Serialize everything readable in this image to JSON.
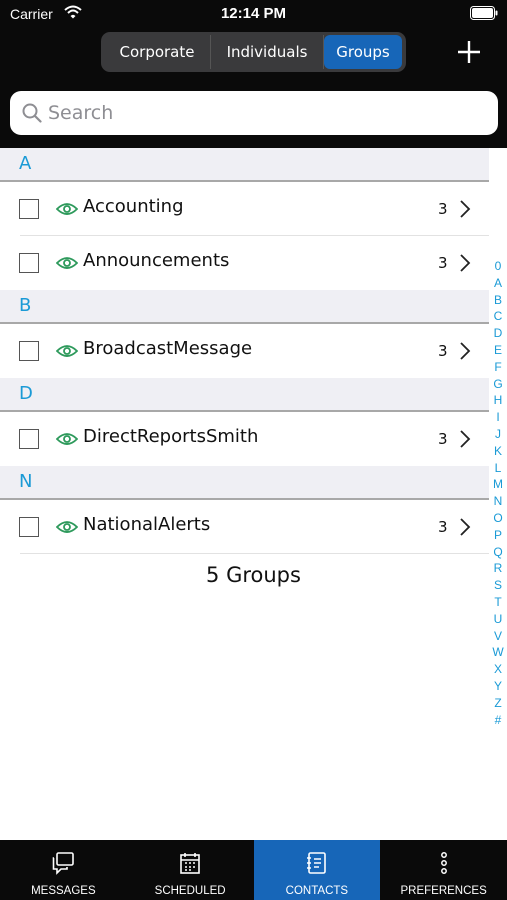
{
  "status": {
    "carrier": "Carrier",
    "time": "12:14 PM"
  },
  "segments": [
    {
      "label": "Corporate",
      "selected": false
    },
    {
      "label": "Individuals",
      "selected": false
    },
    {
      "label": "Groups",
      "selected": true
    }
  ],
  "search": {
    "placeholder": "Search",
    "value": ""
  },
  "sections": [
    {
      "letter": "A",
      "rows": [
        {
          "name": "Accounting",
          "count": "3"
        },
        {
          "name": "Announcements",
          "count": "3"
        }
      ]
    },
    {
      "letter": "B",
      "rows": [
        {
          "name": "BroadcastMessage",
          "count": "3"
        }
      ]
    },
    {
      "letter": "D",
      "rows": [
        {
          "name": "DirectReportsSmith",
          "count": "3"
        }
      ]
    },
    {
      "letter": "N",
      "rows": [
        {
          "name": "NationalAlerts",
          "count": "3"
        }
      ]
    }
  ],
  "footer": {
    "count_text": "5 Groups"
  },
  "index_letters": [
    "0",
    "A",
    "B",
    "C",
    "D",
    "E",
    "F",
    "G",
    "H",
    "I",
    "J",
    "K",
    "L",
    "M",
    "N",
    "O",
    "P",
    "Q",
    "R",
    "S",
    "T",
    "U",
    "V",
    "W",
    "X",
    "Y",
    "Z",
    "#"
  ],
  "tabs": [
    {
      "label": "MESSAGES",
      "icon": "messages-icon",
      "active": false
    },
    {
      "label": "SCHEDULED",
      "icon": "calendar-icon",
      "active": false
    },
    {
      "label": "CONTACTS",
      "icon": "contacts-icon",
      "active": true
    },
    {
      "label": "PREFERENCES",
      "icon": "more-vertical-icon",
      "active": false
    }
  ],
  "colors": {
    "accent": "#1766b8",
    "section_letter": "#1a9ad6",
    "eye": "#2e9a5c",
    "header_bg": "#0a0a0a"
  }
}
